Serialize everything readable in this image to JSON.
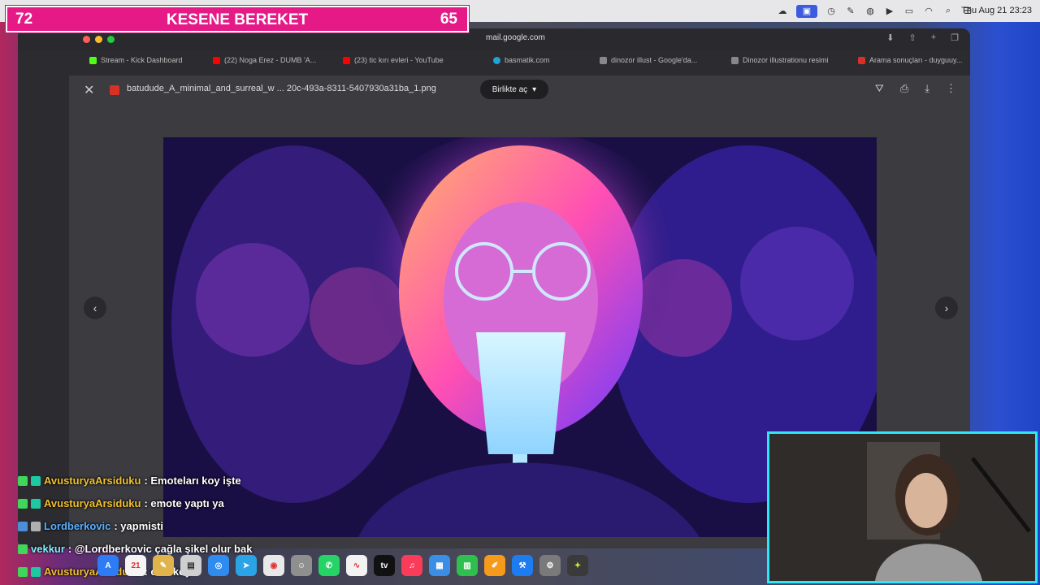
{
  "menubar": {
    "icons": [
      "cloud-icon",
      "screen-share-icon",
      "clock-icon",
      "paint-icon",
      "water-icon",
      "play-icon",
      "battery-icon",
      "wifi-icon",
      "search-icon",
      "control-center-icon"
    ],
    "clock": "Thu Aug 21  23:23"
  },
  "scoreboard": {
    "left_score": "72",
    "title": "KESENE BEREKET",
    "right_score": "65",
    "color": "#e51a87"
  },
  "browser": {
    "url": "mail.google.com",
    "tabs": [
      {
        "label": "Stream - Kick Dashboard",
        "icon": "kick-icon",
        "color": "#53fc18"
      },
      {
        "label": "(22) Noga Erez - DUMB 'A...",
        "icon": "youtube-icon",
        "color": "#ff0000"
      },
      {
        "label": "(23) tic kırı evleri - YouTube",
        "icon": "youtube-icon",
        "color": "#ff0000"
      },
      {
        "label": "basmatik.com",
        "icon": "globe-icon",
        "color": "#1fa3d8"
      },
      {
        "label": "dinozor illust - Google'da...",
        "icon": "google-icon",
        "color": "#888888"
      },
      {
        "label": "Dinozor illustrationu resimi",
        "icon": "page-icon",
        "color": "#888888"
      },
      {
        "label": "Arama sonuçları - duyguuy...",
        "icon": "gmail-icon",
        "color": "#d93025"
      }
    ]
  },
  "viewer": {
    "filename": "batudude_A_minimal_and_surreal_w ... 20c-493a-8311-5407930a31ba_1.png",
    "open_with": "Birlikte aç",
    "icons": [
      "drive-add-icon",
      "print-icon",
      "download-icon",
      "more-icon"
    ]
  },
  "chat": [
    {
      "user": "AvusturyaArsiduku",
      "text": ": Emoteları koy işte",
      "user_color": "gold"
    },
    {
      "user": "AvusturyaArsiduku",
      "text": ": emote yaptı ya",
      "user_color": "gold"
    },
    {
      "user": "Lordberkovic",
      "text": ": yapmisti",
      "user_color": "blue"
    },
    {
      "user": "vekkur",
      "text": ": @Lordberkovic çağla şikel olur bak",
      "user_color": "cyan"
    },
    {
      "user": "AvusturyaArsiduku",
      "text": ": onu koy",
      "user_color": "gold"
    }
  ],
  "dock": {
    "apps": [
      "app-store-icon",
      "calendar-icon",
      "notes-icon",
      "files-icon",
      "safari-icon",
      "telegram-icon",
      "chrome-icon",
      "finder-icon",
      "whatsapp-icon",
      "stocks-icon",
      "tv-icon",
      "music-icon",
      "keynote-icon",
      "numbers-icon",
      "pages-icon",
      "xcode-icon",
      "settings-icon",
      "brush-icon"
    ],
    "calendar_day": "21",
    "tv_label": "tv"
  }
}
